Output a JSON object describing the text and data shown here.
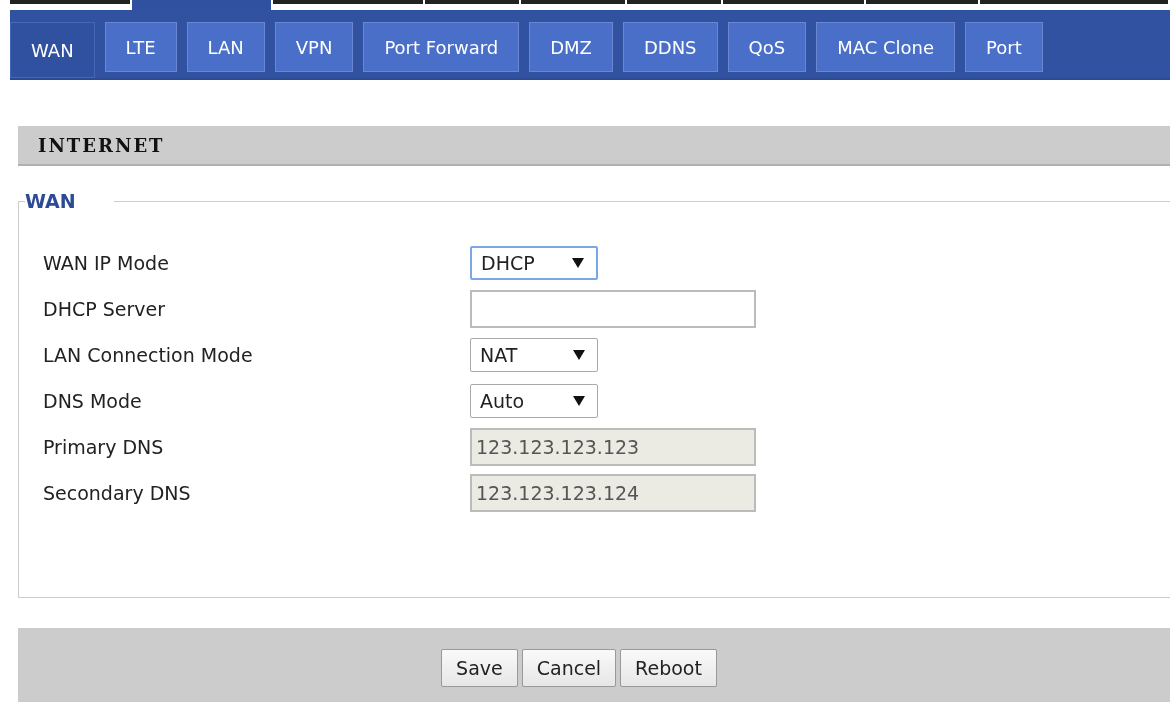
{
  "tabs": [
    {
      "label": "WAN",
      "selected": true
    },
    {
      "label": "LTE",
      "selected": false
    },
    {
      "label": "LAN",
      "selected": false
    },
    {
      "label": "VPN",
      "selected": false
    },
    {
      "label": "Port Forward",
      "selected": false
    },
    {
      "label": "DMZ",
      "selected": false
    },
    {
      "label": "DDNS",
      "selected": false
    },
    {
      "label": "QoS",
      "selected": false
    },
    {
      "label": "MAC Clone",
      "selected": false
    },
    {
      "label": "Port",
      "selected": false
    }
  ],
  "section": {
    "title": "INTERNET"
  },
  "fieldset": {
    "legend": "WAN",
    "fields": [
      {
        "label": "WAN IP Mode",
        "kind": "select",
        "value": "DHCP",
        "focused": true
      },
      {
        "label": "DHCP Server",
        "kind": "text",
        "disabled": false
      },
      {
        "label": "LAN Connection Mode",
        "kind": "select",
        "value": "NAT",
        "focused": false
      },
      {
        "label": "DNS Mode",
        "kind": "select",
        "value": "Auto",
        "focused": false
      },
      {
        "label": "Primary DNS",
        "kind": "text",
        "value": "123.123.123.123",
        "disabled": true
      },
      {
        "label": "Secondary DNS",
        "kind": "text",
        "value": "123.123.123.124",
        "disabled": true
      }
    ]
  },
  "buttons": [
    "Save",
    "Cancel",
    "Reboot"
  ]
}
